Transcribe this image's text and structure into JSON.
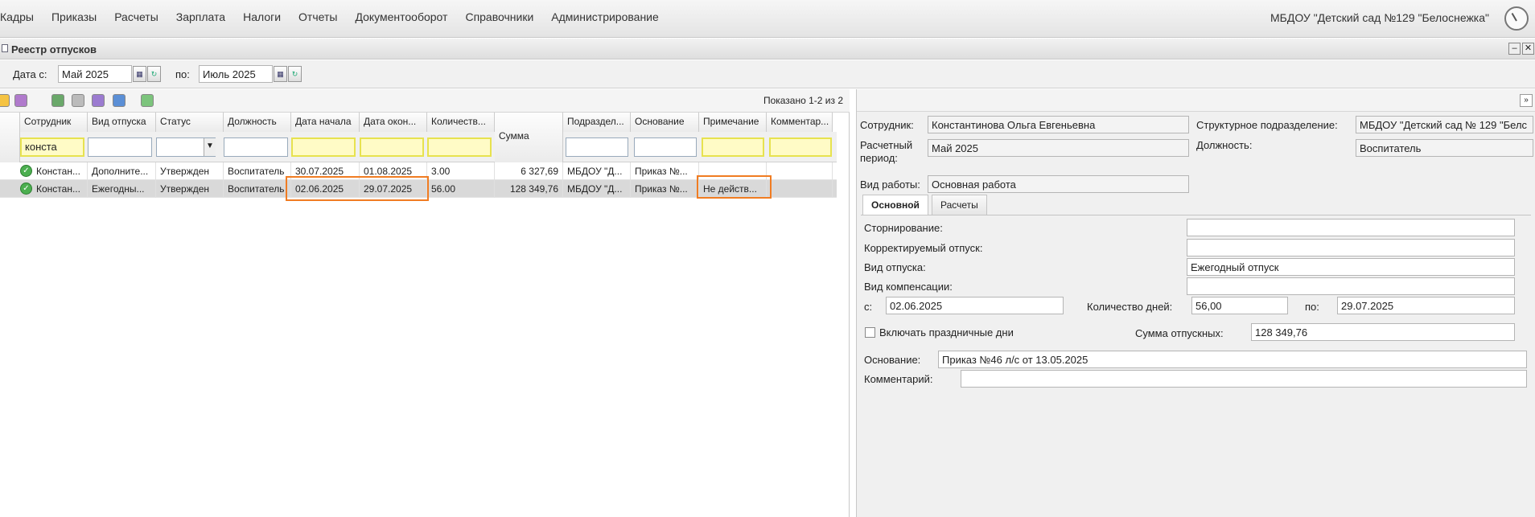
{
  "menu": [
    "Кадры",
    "Приказы",
    "Расчеты",
    "Зарплата",
    "Налоги",
    "Отчеты",
    "Документооборот",
    "Справочники",
    "Администрирование"
  ],
  "org": "МБДОУ \"Детский сад №129 \"Белоснежка\"",
  "window_title": "Реестр отпусков",
  "filter": {
    "from_label": "Дата с:",
    "from_value": "Май 2025",
    "to_label": "по:",
    "to_value": "Июль 2025"
  },
  "shown": "Показано 1-2 из 2",
  "columns": [
    "Сотрудник",
    "Вид отпуска",
    "Статус",
    "Должность",
    "Дата начала",
    "Дата окон...",
    "Количеств...",
    "Сумма",
    "Подраздел...",
    "Основание",
    "Примечание",
    "Комментар..."
  ],
  "filter_employee": "конста",
  "rows": [
    [
      "Констан...",
      "Дополните...",
      "Утвержден",
      "Воспитатель",
      "30.07.2025",
      "01.08.2025",
      "3.00",
      "6 327,69",
      "МБДОУ \"Д...",
      "Приказ №...",
      ""
    ],
    [
      "Констан...",
      "Ежегодны...",
      "Утвержден",
      "Воспитатель",
      "02.06.2025",
      "29.07.2025",
      "56.00",
      "128 349,76",
      "МБДОУ \"Д...",
      "Приказ №...",
      "Не действ..."
    ]
  ],
  "details": {
    "employee_label": "Сотрудник:",
    "employee": "Константинова Ольга Евгеньевна",
    "dept_label": "Структурное подразделение:",
    "dept": "МБДОУ \"Детский сад № 129 \"Белс",
    "period_label1": "Расчетный",
    "period_label2": "период:",
    "period": "Май 2025",
    "position_label": "Должность:",
    "position": "Воспитатель",
    "worktype_label": "Вид работы:",
    "worktype": "Основная работа"
  },
  "tabs": [
    "Основной",
    "Расчеты"
  ],
  "main": {
    "storno_label": "Сторнирование:",
    "storno": "",
    "corr_label": "Корректируемый отпуск:",
    "corr": "",
    "type_label": "Вид отпуска:",
    "type": "Ежегодный отпуск",
    "comp_label": "Вид компенсации:",
    "comp": "",
    "from_label": "с:",
    "from": "02.06.2025",
    "days_label": "Количество дней:",
    "days": "56,00",
    "to_label": "по:",
    "to": "29.07.2025",
    "holidays_label": "Включать праздничные дни",
    "sum_label": "Сумма отпускных:",
    "sum": "128 349,76",
    "basis_label": "Основание:",
    "basis": "Приказ №46 л/с от 13.05.2025",
    "comment_label": "Комментарий:",
    "comment": ""
  }
}
